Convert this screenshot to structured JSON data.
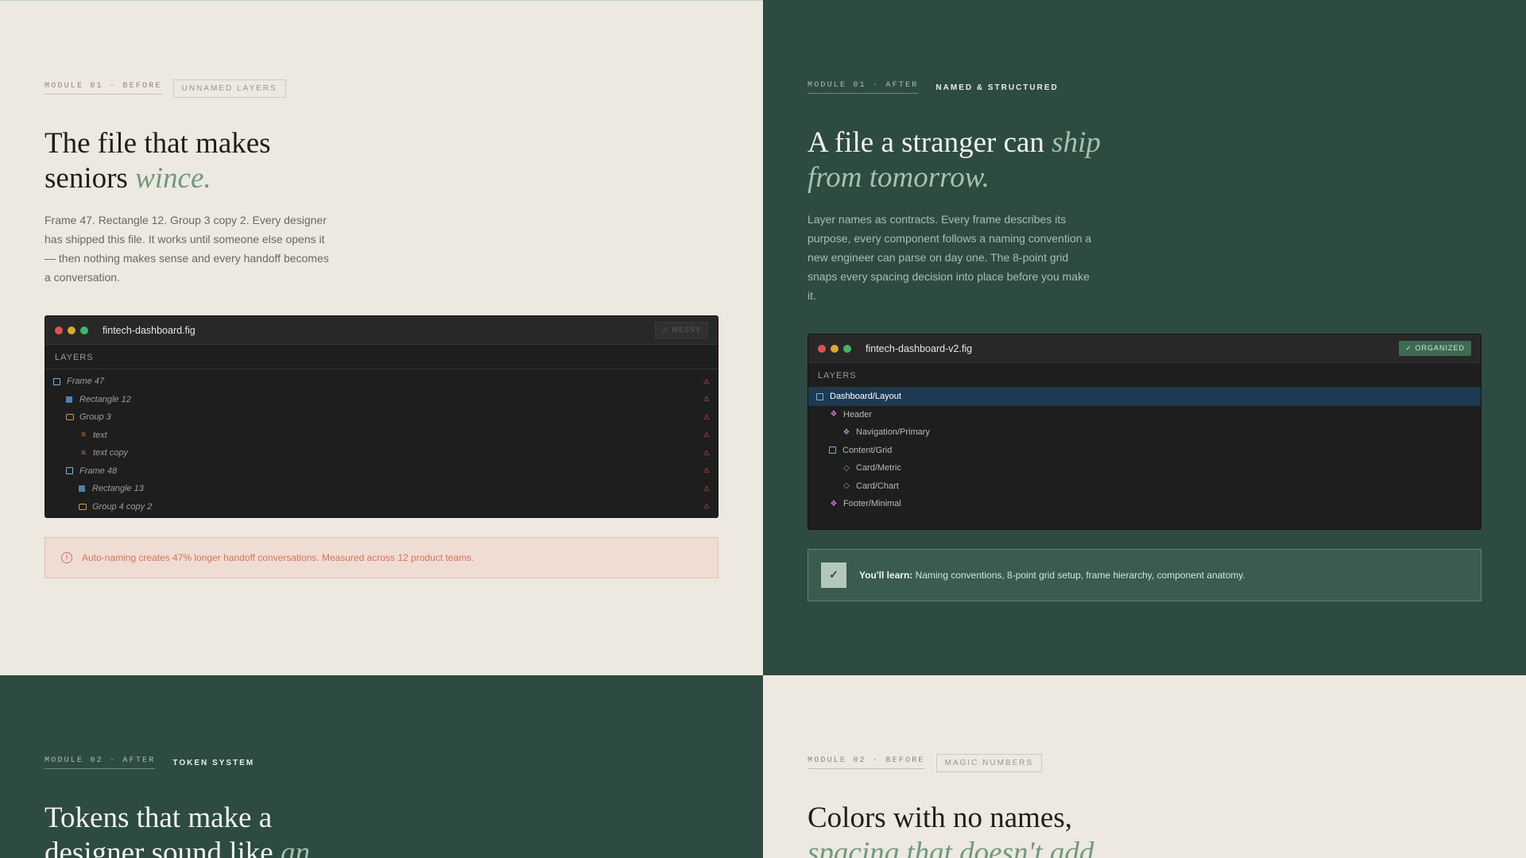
{
  "tl": {
    "module": "MODULE 01 · BEFORE",
    "tag": "UNNAMED LAYERS",
    "title_line1": "The file that makes",
    "title_line2": "seniors ",
    "title_em": "wince.",
    "body": "Frame 47. Rectangle 12. Group 3 copy 2. Every designer has shipped this file. It works until someone else opens it — then nothing makes sense and every handoff becomes a conversation.",
    "window": {
      "filename": "fintech-dashboard.fig",
      "badge": "⚠ MESSY",
      "layers_label": "LAYERS",
      "layers": [
        {
          "name": "Frame 47",
          "icon": "frame-icon"
        },
        {
          "name": "Rectangle 12",
          "icon": "rectangle-icon"
        },
        {
          "name": "Group 3",
          "icon": "group-icon"
        },
        {
          "name": "text",
          "icon": "text-icon"
        },
        {
          "name": "text copy",
          "icon": "text-icon"
        },
        {
          "name": "Frame 48",
          "icon": "frame-icon"
        },
        {
          "name": "Rectangle 13",
          "icon": "rectangle-icon"
        },
        {
          "name": "Group 4 copy 2",
          "icon": "group-icon"
        }
      ]
    },
    "note": "Auto-naming creates 47% longer handoff conversations. Measured across 12 product teams."
  },
  "tr": {
    "module": "MODULE 01 · AFTER",
    "tag": "NAMED & STRUCTURED",
    "title_line1": "A file a stranger can ",
    "title_em1": "ship",
    "title_em2": "from tomorrow.",
    "body": "Layer names as contracts. Every frame describes its purpose, every component follows a naming convention a new engineer can parse on day one. The 8-point grid snaps every spacing decision into place before you make it.",
    "window": {
      "filename": "fintech-dashboard-v2.fig",
      "badge": "✓ ORGANIZED",
      "layers_label": "LAYERS",
      "layers": [
        {
          "name": "Dashboard/Layout",
          "icon": "frame-icon"
        },
        {
          "name": "Header",
          "icon": "component-icon"
        },
        {
          "name": "Navigation/Primary",
          "icon": "component-icon"
        },
        {
          "name": "Content/Grid",
          "icon": "frame-icon"
        },
        {
          "name": "Card/Metric",
          "icon": "instance-icon"
        },
        {
          "name": "Card/Chart",
          "icon": "instance-icon"
        },
        {
          "name": "Footer/Minimal",
          "icon": "component-icon"
        }
      ]
    },
    "learn_label": "You'll learn:",
    "learn_text": " Naming conventions, 8-point grid setup, frame hierarchy, component anatomy."
  },
  "bl": {
    "module": "MODULE 02 · AFTER",
    "tag": "TOKEN SYSTEM",
    "title_line1": "Tokens that make a",
    "title_line2": "designer sound like ",
    "title_em": "an"
  },
  "br": {
    "module": "MODULE 02 · BEFORE",
    "tag": "MAGIC NUMBERS",
    "title_line1": "Colors with no names,",
    "title_em": "spacing that doesn't add"
  },
  "colors": {
    "dark_green": "#2e4b41",
    "cream": "#ede8e0",
    "accent_green": "#6d9a7c",
    "warning": "#d7735a"
  }
}
